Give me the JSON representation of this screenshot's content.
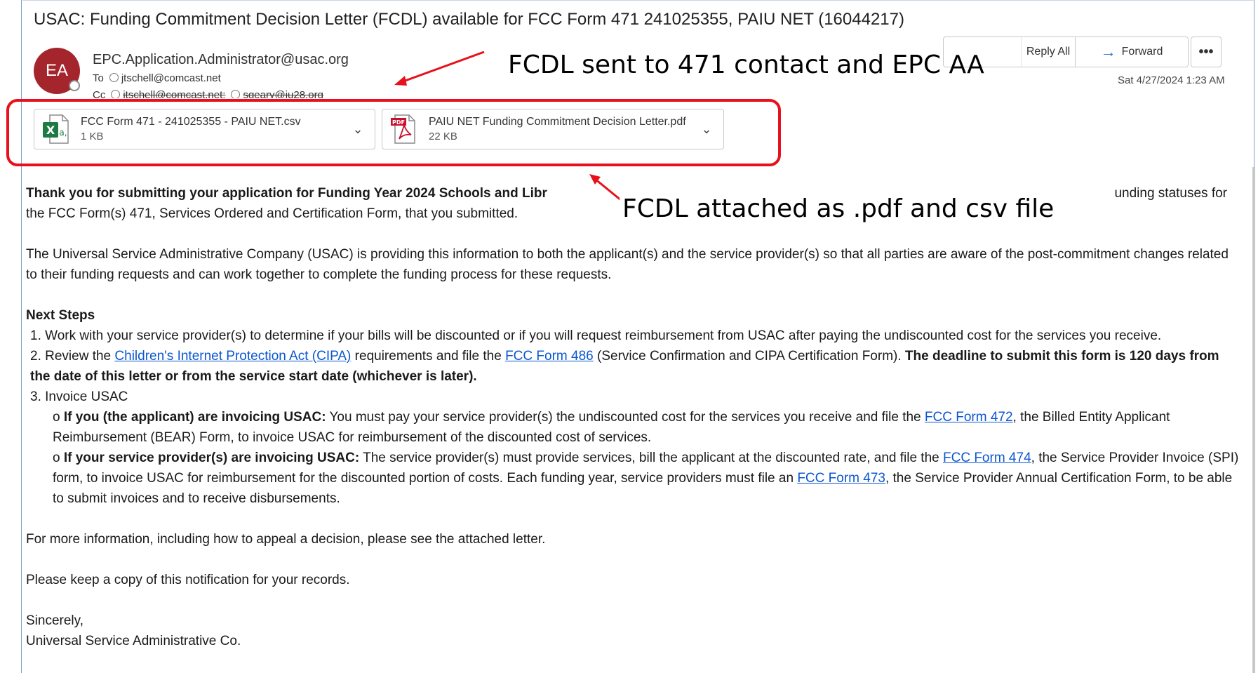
{
  "email": {
    "subject": "USAC: Funding Commitment Decision Letter (FCDL) available for FCC Form 471 241025355, PAIU NET (16044217)",
    "avatar_initials": "EA",
    "avatar_color": "#a4262c",
    "from": "EPC.Application.Administrator@usac.org",
    "to_label": "To",
    "to_address": "jtschell@comcast.net",
    "cc_label": "Cc",
    "cc_address_1": "jtschell@comcast.net;",
    "cc_address_2": "sgeary@iu28.org",
    "date": "Sat 4/27/2024 1:23 AM"
  },
  "toolbar": {
    "reply_all_label": "Reply All",
    "forward_label": "Forward",
    "more_label": "•••"
  },
  "attachments": [
    {
      "name": "FCC Form 471 - 241025355 - PAIU NET.csv",
      "size": "1 KB",
      "icon": "excel-icon"
    },
    {
      "name": "PAIU NET Funding Commitment Decision Letter.pdf",
      "size": "22 KB",
      "icon": "pdf-icon"
    }
  ],
  "annotations": {
    "callout_1": "FCDL sent to 471 contact and EPC AA",
    "callout_2": "FCDL attached as .pdf and csv file",
    "highlight_color": "#e8101a"
  },
  "body": {
    "intro_bold": "Thank you for submitting your application for Funding Year 2024 Schools and Libr",
    "intro_tail": "unding statuses for",
    "intro_line2": "the FCC Form(s) 471, Services Ordered and Certification Form, that you submitted.",
    "usac_para": "The Universal Service Administrative Company (USAC) is providing this information to both the applicant(s) and the service provider(s) so that all parties are aware of the post-commitment changes related to their funding requests and can work together to complete the funding process for these requests.",
    "next_steps_heading": "Next Steps",
    "step1": "1. Work with your service provider(s) to determine if your bills will be discounted or if you will request reimbursement from USAC after paying the undiscounted cost for the services you receive.",
    "step2_pre": "2. Review the ",
    "step2_link1": "Children's Internet Protection Act (CIPA)",
    "step2_mid": " requirements and file the ",
    "step2_link2": "FCC Form 486",
    "step2_post": " (Service Confirmation and CIPA Certification Form). ",
    "step2_bold": "The deadline to submit this form is 120 days from the date of this letter or from the service start date (whichever is later).",
    "step3": "3. Invoice USAC",
    "bullet_a_prefix": "o ",
    "bullet_a_bold": "If you (the applicant) are invoicing USAC:",
    "bullet_a_text": " You must pay your service provider(s) the undiscounted cost for the services you receive and file the ",
    "bullet_a_link": "FCC Form 472",
    "bullet_a_post": ", the Billed Entity Applicant Reimbursement (BEAR) Form, to invoice USAC for reimbursement of the discounted cost of services.",
    "bullet_b_prefix": "o ",
    "bullet_b_bold": "If your service provider(s) are invoicing USAC:",
    "bullet_b_text": " The service provider(s) must provide services, bill the applicant at the discounted rate, and file the ",
    "bullet_b_link1": "FCC Form 474",
    "bullet_b_mid": ", the Service Provider Invoice (SPI) form, to invoice USAC for reimbursement for the discounted portion of costs. Each funding year, service providers must file an ",
    "bullet_b_link2": "FCC Form 473",
    "bullet_b_post": ", the Service Provider Annual Certification Form, to be able to submit invoices and to receive disbursements.",
    "more_info": "For more information, including how to appeal a decision, please see the attached letter.",
    "keep_copy": "Please keep a copy of this notification for your records.",
    "closing": "Sincerely,",
    "signature": "Universal Service Administrative Co."
  }
}
